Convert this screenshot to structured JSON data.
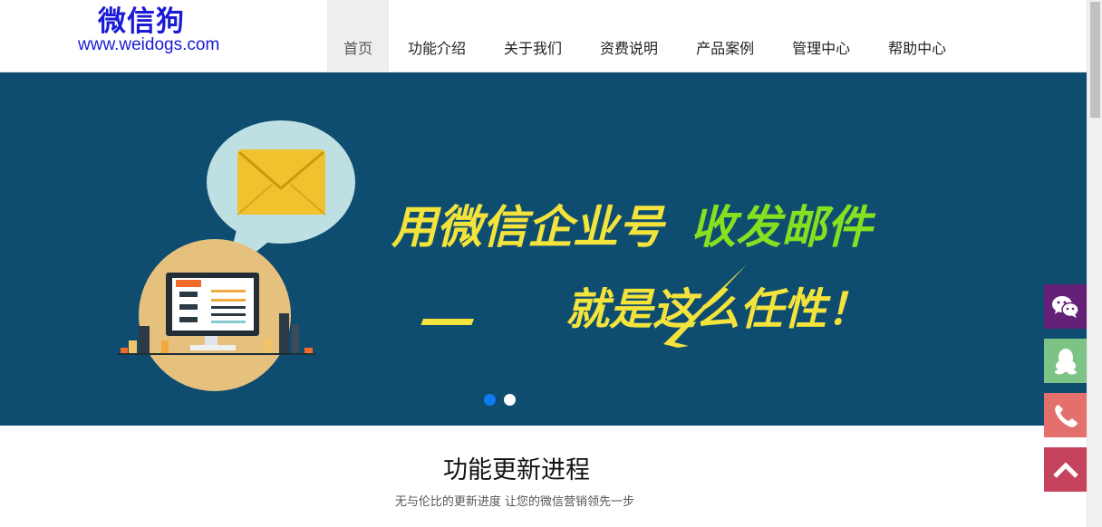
{
  "header": {
    "logo_cn": "微信狗",
    "logo_url": "www.weidogs.com",
    "nav": [
      {
        "label": "首页",
        "active": true
      },
      {
        "label": "功能介绍",
        "active": false
      },
      {
        "label": "关于我们",
        "active": false
      },
      {
        "label": "资费说明",
        "active": false
      },
      {
        "label": "产品案例",
        "active": false
      },
      {
        "label": "管理中心",
        "active": false
      },
      {
        "label": "帮助中心",
        "active": false
      }
    ]
  },
  "banner": {
    "headline_part1": "用微信企业号",
    "headline_part2": "收发邮件",
    "subline": "就是这么任性！",
    "background_color": "#0e4d70",
    "slides": 2,
    "active_slide": 1
  },
  "side_buttons": [
    {
      "icon": "wechat-icon",
      "color": "#652078"
    },
    {
      "icon": "qq-icon",
      "color": "#7ec386"
    },
    {
      "icon": "phone-icon",
      "color": "#e3706d"
    },
    {
      "icon": "back-to-top-icon",
      "color": "#c6435d"
    }
  ],
  "section": {
    "title": "功能更新进程",
    "subtitle": "无与伦比的更新进度 让您的微信营销领先一步"
  }
}
